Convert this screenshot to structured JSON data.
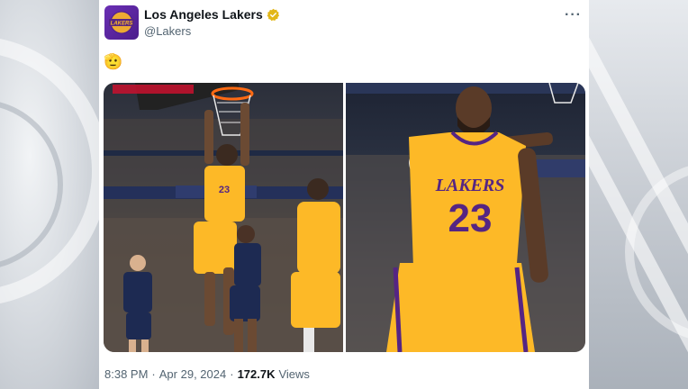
{
  "account": {
    "display_name": "Los Angeles Lakers",
    "handle": "@Lakers",
    "avatar_text": "LAKERS"
  },
  "tweet": {
    "text": "🫡",
    "photos": [
      {
        "alt": "",
        "jersey": "23"
      },
      {
        "alt": "",
        "jersey": "23",
        "jersey_text": "LAKERS"
      }
    ],
    "time": "8:38 PM",
    "date": "Apr 29, 2024",
    "separator": "·",
    "views_count": "172.7K",
    "views_label": "Views"
  },
  "menu": {
    "more_label": "···"
  },
  "colors": {
    "lakers_gold": "#fdb927",
    "lakers_purple": "#552583",
    "nuggets_navy": "#1d2a52",
    "verified_gold": "#e2b719"
  }
}
